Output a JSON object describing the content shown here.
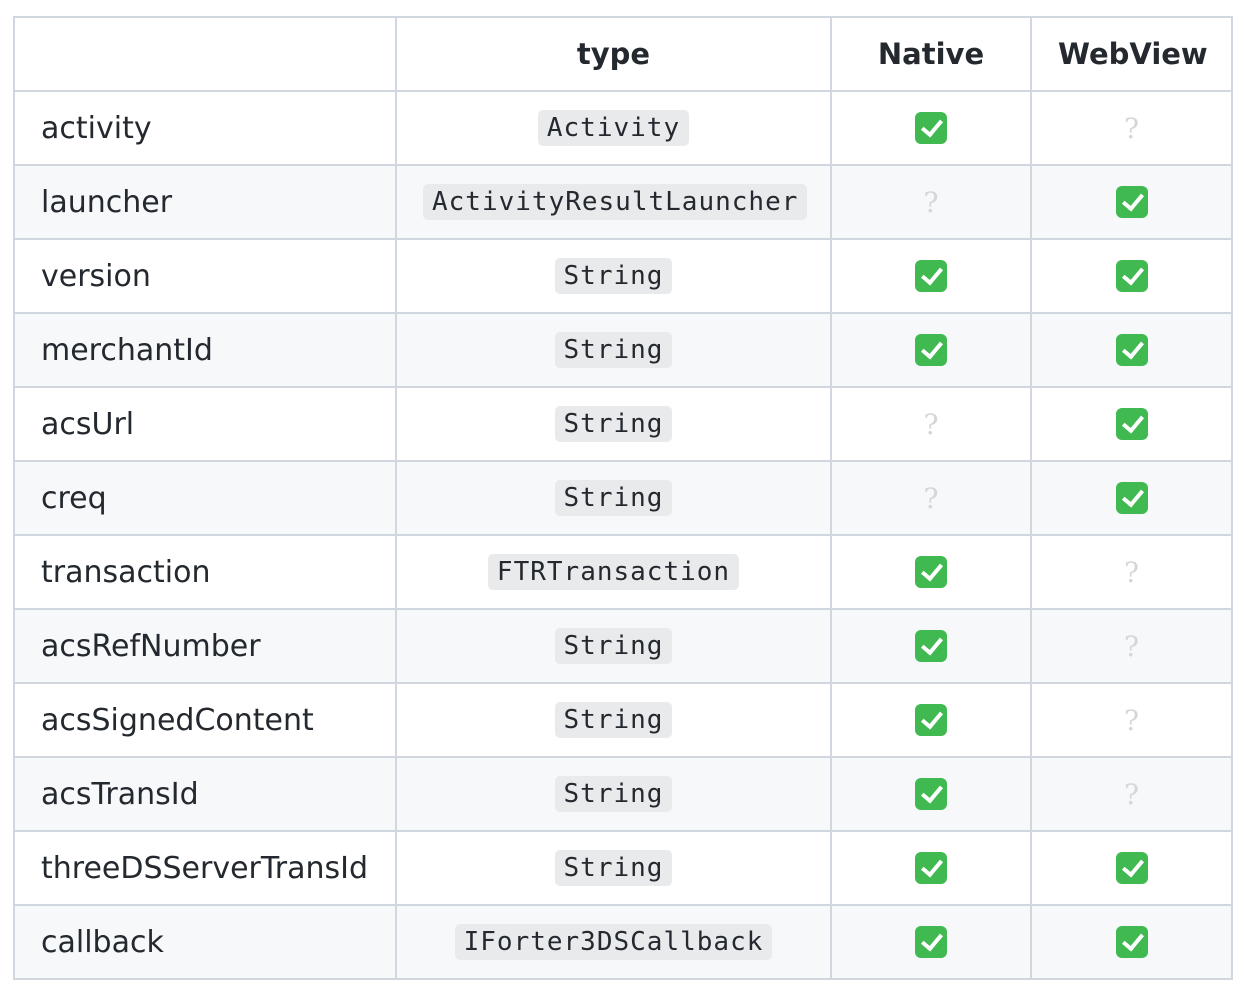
{
  "header": {
    "param": "",
    "type": "type",
    "native": "Native",
    "webview": "WebView"
  },
  "rows": [
    {
      "name": "activity",
      "type": "Activity",
      "native": "check-icon",
      "webview": "question-icon"
    },
    {
      "name": "launcher",
      "type": "ActivityResultLauncher",
      "native": "question-icon",
      "webview": "check-icon"
    },
    {
      "name": "version",
      "type": "String",
      "native": "check-icon",
      "webview": "check-icon"
    },
    {
      "name": "merchantId",
      "type": "String",
      "native": "check-icon",
      "webview": "check-icon"
    },
    {
      "name": "acsUrl",
      "type": "String",
      "native": "question-icon",
      "webview": "check-icon"
    },
    {
      "name": "creq",
      "type": "String",
      "native": "question-icon",
      "webview": "check-icon"
    },
    {
      "name": "transaction",
      "type": "FTRTransaction",
      "native": "check-icon",
      "webview": "question-icon"
    },
    {
      "name": "acsRefNumber",
      "type": "String",
      "native": "check-icon",
      "webview": "question-icon"
    },
    {
      "name": "acsSignedContent",
      "type": "String",
      "native": "check-icon",
      "webview": "question-icon"
    },
    {
      "name": "acsTransId",
      "type": "String",
      "native": "check-icon",
      "webview": "question-icon"
    },
    {
      "name": "threeDSServerTransId",
      "type": "String",
      "native": "check-icon",
      "webview": "check-icon"
    },
    {
      "name": "callback",
      "type": "IForter3DSCallback",
      "native": "check-icon",
      "webview": "check-icon"
    }
  ],
  "icons": {
    "check": "white-check-mark-icon",
    "question": "white-question-mark-icon"
  },
  "colors": {
    "check_bg": "#3fb950",
    "question": "#d6d6d6",
    "border": "#d0d7de",
    "code_bg": "#e8eaec",
    "stripe": "#f6f8fa"
  }
}
